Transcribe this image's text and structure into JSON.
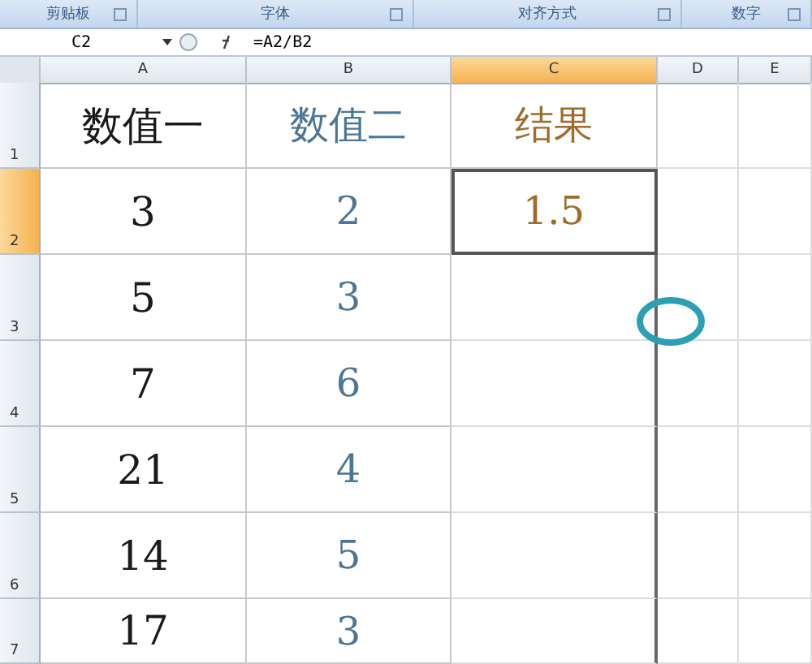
{
  "ribbon_groups": [
    {
      "label": "剪贴板"
    },
    {
      "label": "字体"
    },
    {
      "label": "对齐方式"
    },
    {
      "label": "数字"
    }
  ],
  "formula_bar": {
    "name_box": "C2",
    "formula": "=A2/B2"
  },
  "columns": [
    {
      "label": "A",
      "selected": false
    },
    {
      "label": "B",
      "selected": false
    },
    {
      "label": "C",
      "selected": true
    },
    {
      "label": "D",
      "selected": false
    },
    {
      "label": "E",
      "selected": false
    }
  ],
  "rows": [
    {
      "header": "1",
      "selected": false,
      "cells": [
        {
          "text": "数值一",
          "selected": false
        },
        {
          "text": "数值二",
          "selected": false
        },
        {
          "text": "结果",
          "selected": false
        }
      ]
    },
    {
      "header": "2",
      "selected": true,
      "cells": [
        {
          "text": "3",
          "selected": false
        },
        {
          "text": "2",
          "selected": false
        },
        {
          "text": "1.5",
          "selected": true
        }
      ]
    },
    {
      "header": "3",
      "selected": false,
      "cells": [
        {
          "text": "5",
          "selected": false
        },
        {
          "text": "3",
          "selected": false
        }
      ]
    },
    {
      "header": "4",
      "selected": false,
      "cells": [
        {
          "text": "7",
          "selected": false
        },
        {
          "text": "6",
          "selected": false
        }
      ]
    },
    {
      "header": "5",
      "selected": false,
      "cells": [
        {
          "text": "21",
          "selected": false
        },
        {
          "text": "4",
          "selected": false
        }
      ]
    },
    {
      "header": "6",
      "selected": false,
      "cells": [
        {
          "text": "14",
          "selected": false
        },
        {
          "text": "5",
          "selected": false
        }
      ]
    },
    {
      "header": "7",
      "selected": false,
      "cells": [
        {
          "text": "17",
          "selected": false
        },
        {
          "text": "3",
          "selected": false
        }
      ]
    }
  ]
}
